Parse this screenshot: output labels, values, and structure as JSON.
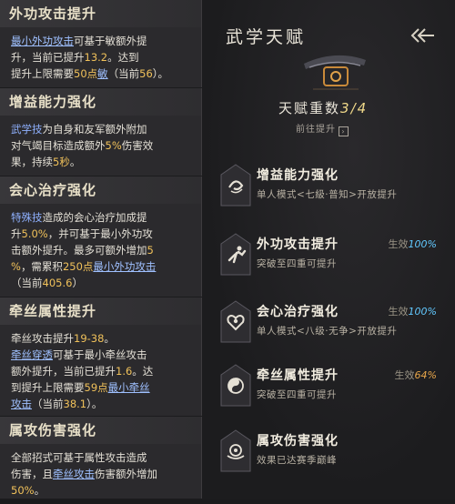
{
  "tooltips": [
    {
      "title": "外功攻击提升",
      "lines": [
        [
          {
            "t": "最小外功攻击",
            "c": "link"
          },
          {
            "t": "可基于敏额外提"
          }
        ],
        [
          {
            "t": "升，当前已提升"
          },
          {
            "t": "13.2",
            "c": "gold"
          },
          {
            "t": "。达到"
          }
        ],
        [
          {
            "t": "提升上限需要"
          },
          {
            "t": "50点",
            "c": "gold"
          },
          {
            "t": "敏",
            "c": "link"
          },
          {
            "t": "（当前"
          },
          {
            "t": "56",
            "c": "gold"
          },
          {
            "t": "）。"
          }
        ]
      ]
    },
    {
      "title": "增益能力强化",
      "lines": [
        [
          {
            "t": "武学技",
            "c": "blue"
          },
          {
            "t": "为自身和友军额外附加"
          }
        ],
        [
          {
            "t": "对气竭目标造成额外"
          },
          {
            "t": "5%",
            "c": "gold"
          },
          {
            "t": "伤害效"
          }
        ],
        [
          {
            "t": "果，持续"
          },
          {
            "t": "5秒",
            "c": "gold"
          },
          {
            "t": "。"
          }
        ]
      ]
    },
    {
      "title": "会心治疗强化",
      "lines": [
        [
          {
            "t": "特殊技",
            "c": "blue"
          },
          {
            "t": "造成的会心治疗加成提"
          }
        ],
        [
          {
            "t": "升"
          },
          {
            "t": "5.0%",
            "c": "gold"
          },
          {
            "t": "，并可基于最小外功攻"
          }
        ],
        [
          {
            "t": "击额外提升。最多可额外增加"
          },
          {
            "t": "5",
            "c": "gold"
          }
        ],
        [
          {
            "t": "%",
            "c": "gold"
          },
          {
            "t": "，需累积"
          },
          {
            "t": "250点",
            "c": "gold"
          },
          {
            "t": "最小外功攻击",
            "c": "link"
          }
        ],
        [
          {
            "t": "（当前"
          },
          {
            "t": "405.6",
            "c": "gold"
          },
          {
            "t": "）"
          }
        ]
      ]
    },
    {
      "title": "牵丝属性提升",
      "lines": [
        [
          {
            "t": "牵丝攻击提升"
          },
          {
            "t": "19-38",
            "c": "gold"
          },
          {
            "t": "。"
          }
        ],
        [
          {
            "t": "牵丝穿透",
            "c": "link"
          },
          {
            "t": "可基于最小牵丝攻击"
          }
        ],
        [
          {
            "t": "额外提升，当前已提升"
          },
          {
            "t": "1.6",
            "c": "gold"
          },
          {
            "t": "。达"
          }
        ],
        [
          {
            "t": "到提升上限需要"
          },
          {
            "t": "59点",
            "c": "gold"
          },
          {
            "t": "最小牵丝",
            "c": "link"
          }
        ],
        [
          {
            "t": "攻击",
            "c": "link"
          },
          {
            "t": "（当前"
          },
          {
            "t": "38.1",
            "c": "gold"
          },
          {
            "t": "）。"
          }
        ]
      ]
    },
    {
      "title": "属攻伤害强化",
      "lines": [
        [
          {
            "t": "全部招式可基于属性攻击造成"
          }
        ],
        [
          {
            "t": "伤害，且"
          },
          {
            "t": "牵丝攻击",
            "c": "link"
          },
          {
            "t": "伤害额外增加"
          }
        ],
        [
          {
            "t": "50%",
            "c": "gold"
          },
          {
            "t": "。"
          }
        ]
      ]
    }
  ],
  "panel": {
    "title": "武学天赋",
    "tier_prefix": "天赋重数",
    "tier_current": "3",
    "tier_max": "/4",
    "goto_label": "前往提升"
  },
  "talents": [
    {
      "name": "增益能力强化",
      "desc": "单人模式<七級·普知>开放提升",
      "status_label": "",
      "status_value": "",
      "status_color": "#62c9ff",
      "icon": "swirl-icon"
    },
    {
      "name": "外功攻击提升",
      "desc": "突破至四重可提升",
      "status_label": "生效",
      "status_value": "100%",
      "status_color": "#62c9ff",
      "icon": "running-figure-icon"
    },
    {
      "name": "会心治疗强化",
      "desc": "单人模式<八级·无争>开放提升",
      "status_label": "生效",
      "status_value": "100%",
      "status_color": "#62c9ff",
      "icon": "heart-icon"
    },
    {
      "name": "牵丝属性提升",
      "desc": "突破至四重可提升",
      "status_label": "生效",
      "status_value": "64%",
      "status_color": "#e8a64a",
      "icon": "yin-yang-icon"
    },
    {
      "name": "属攻伤害强化",
      "desc": "效果已达赛季巅峰",
      "status_label": "",
      "status_value": "",
      "status_color": "#62c9ff",
      "icon": "orb-icon"
    }
  ],
  "colors": {
    "link": "#9fc0ff",
    "blue": "#8fb1ff",
    "gold": "#f0c15a",
    "accent": "#62c9ff"
  }
}
